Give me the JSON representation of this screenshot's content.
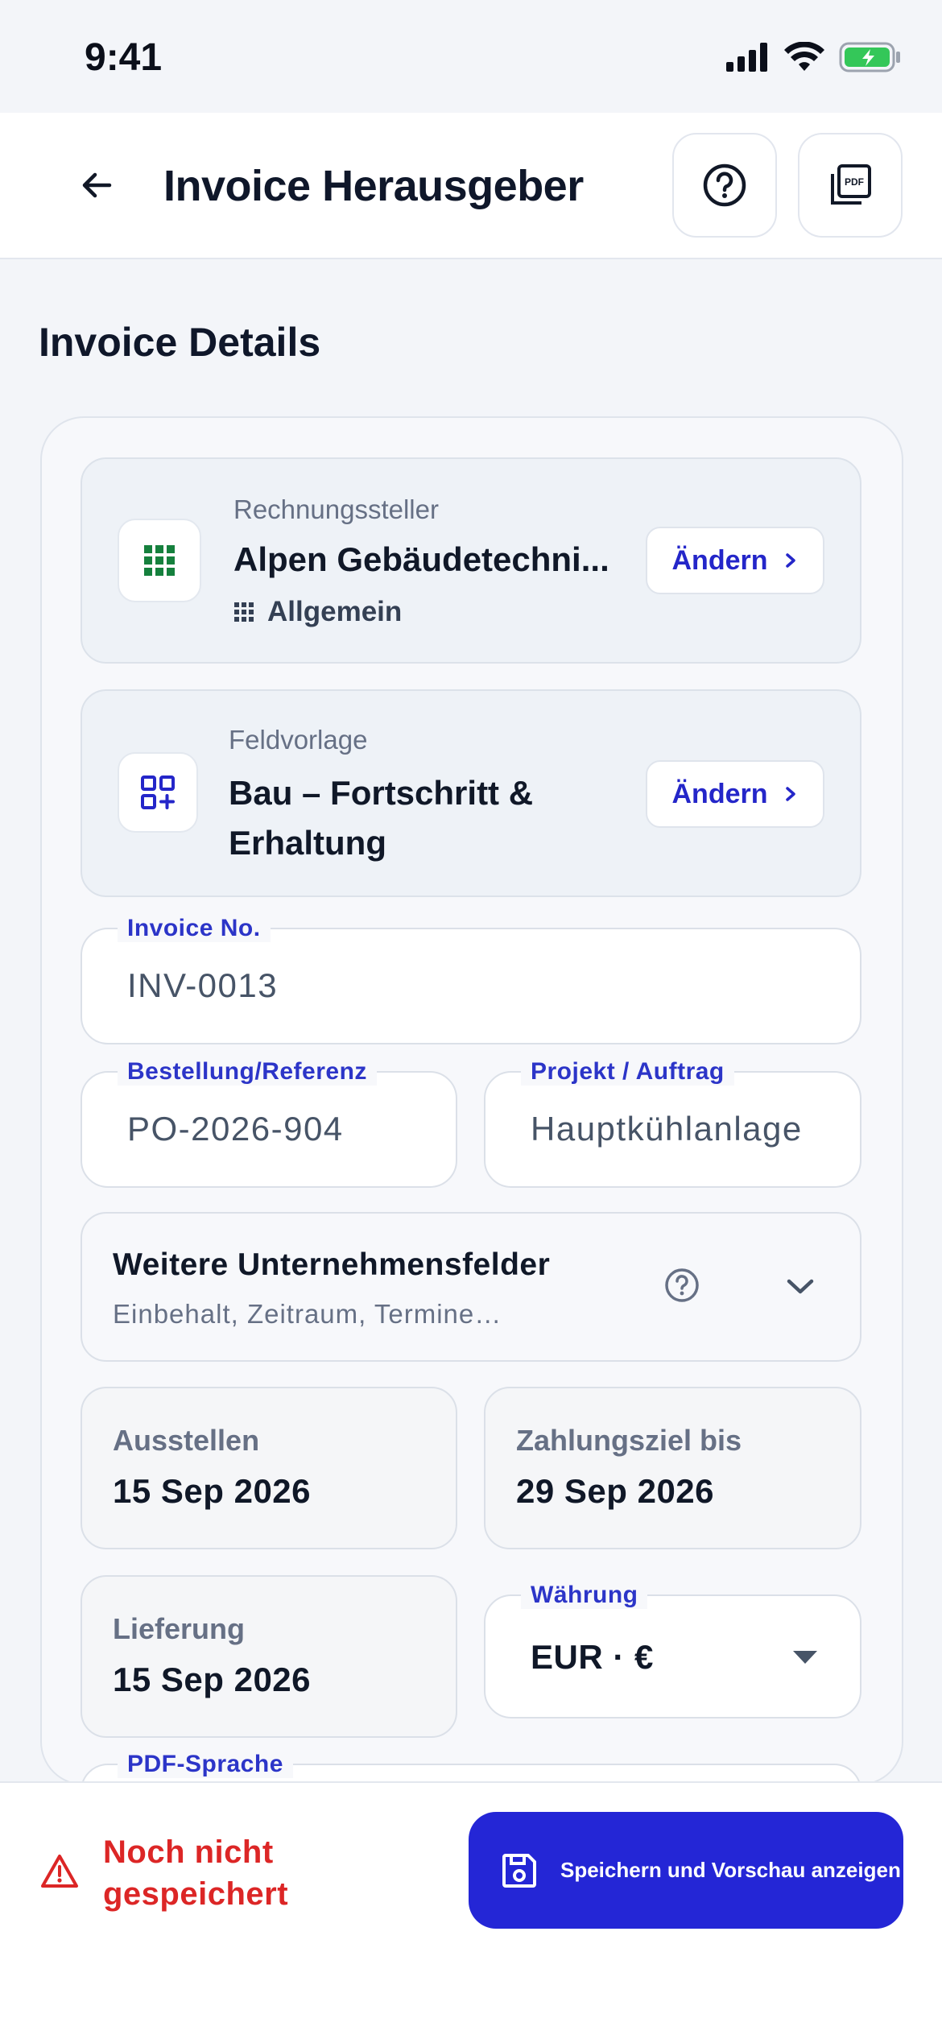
{
  "status_bar": {
    "time": "9:41"
  },
  "header": {
    "title": "Invoice Herausgeber"
  },
  "section": {
    "title": "Invoice Details"
  },
  "issuer": {
    "label": "Rechnungssteller",
    "name": "Alpen Gebäudetechni...",
    "category": "Allgemein",
    "change_label": "Ändern"
  },
  "template": {
    "label": "Feldvorlage",
    "name_line1": "Bau – Fortschritt &",
    "name_line2": "Erhaltung",
    "change_label": "Ändern"
  },
  "fields": {
    "invoice_no": {
      "label": "Invoice No.",
      "value": "INV-0013"
    },
    "order_ref": {
      "label": "Bestellung/Referenz",
      "value": "PO-2026-904"
    },
    "project": {
      "label": "Projekt / Auftrag",
      "value": "Hauptkühlanlage"
    }
  },
  "more_fields": {
    "title": "Weitere Unternehmensfelder",
    "subtitle": "Einbehalt, Zeitraum, Termine…"
  },
  "dates": {
    "issue": {
      "label": "Ausstellen",
      "value": "15 Sep 2026"
    },
    "due": {
      "label": "Zahlungsziel bis",
      "value": "29 Sep 2026"
    },
    "delivery": {
      "label": "Lieferung",
      "value": "15 Sep 2026"
    }
  },
  "currency": {
    "label": "Währung",
    "value": "EUR · €"
  },
  "pdf_language": {
    "label": "PDF-Sprache"
  },
  "footer": {
    "unsaved_text": "Noch nicht gespeichert",
    "save_button": "Speichern und Vorschau anzeigen"
  },
  "colors": {
    "accent": "#2426d6",
    "link": "#2c35c8",
    "warning": "#dc2626",
    "issuer_icon": "#15803d",
    "battery": "#34c759"
  }
}
